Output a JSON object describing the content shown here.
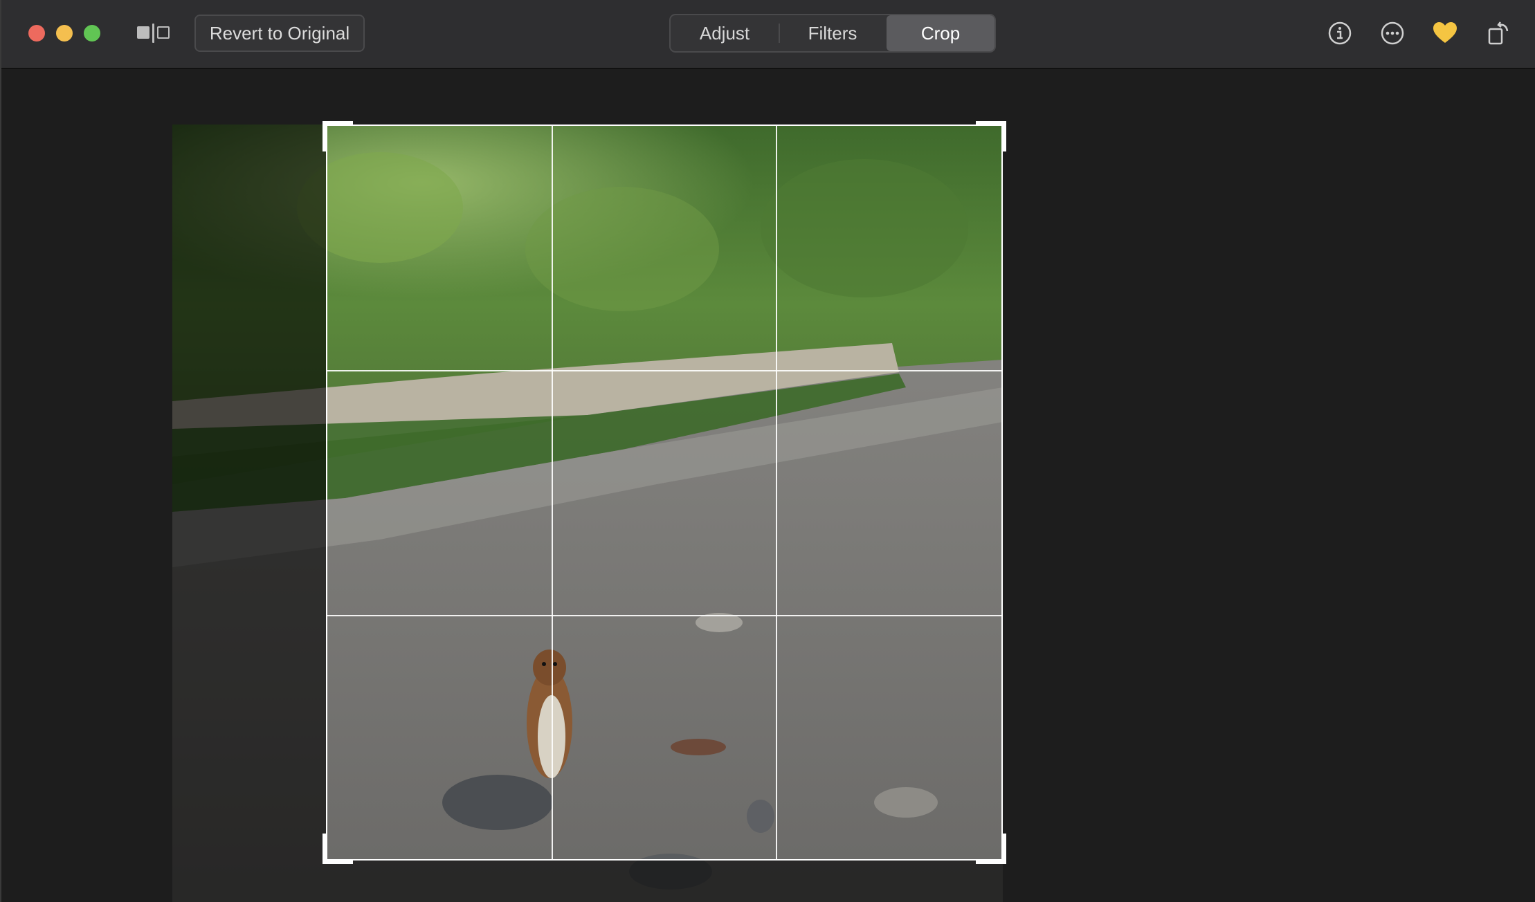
{
  "toolbar": {
    "revert_label": "Revert to Original",
    "tabs": [
      {
        "label": "Adjust",
        "active": false
      },
      {
        "label": "Filters",
        "active": false
      },
      {
        "label": "Crop",
        "active": true
      }
    ],
    "icons": {
      "info": "info-icon",
      "more": "more-icon",
      "favorite": "heart-icon",
      "rotate": "rotate-icon"
    },
    "favorite_color": "#f5c542"
  },
  "window_controls": {
    "close_color": "#ed6a5e",
    "minimize_color": "#f4bf4f",
    "zoom_color": "#61c554"
  },
  "crop": {
    "grid": "3x3"
  }
}
